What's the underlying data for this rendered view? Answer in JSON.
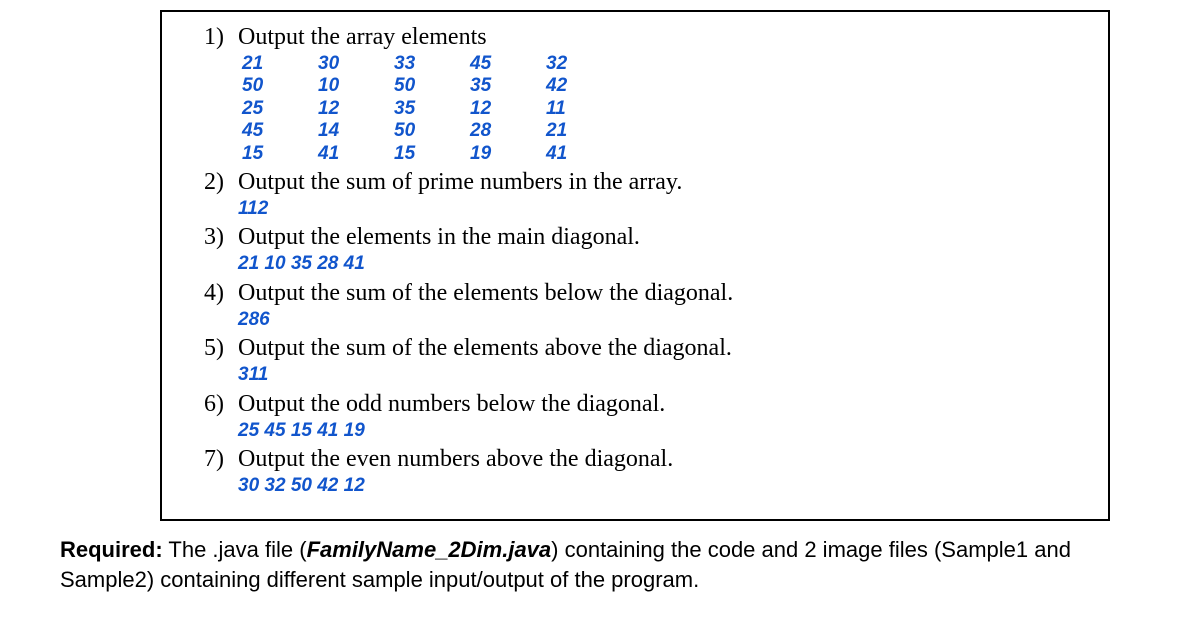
{
  "items": [
    {
      "num": "1)",
      "text": "Output the array elements",
      "output_type": "matrix",
      "matrix": [
        [
          "21",
          "30",
          "33",
          "45",
          "32"
        ],
        [
          "50",
          "10",
          "50",
          "35",
          "42"
        ],
        [
          "25",
          "12",
          "35",
          "12",
          "11"
        ],
        [
          "45",
          "14",
          "50",
          "28",
          "21"
        ],
        [
          "15",
          "41",
          "15",
          "19",
          "41"
        ]
      ]
    },
    {
      "num": "2)",
      "text": "Output the sum of prime numbers in the array.",
      "output_type": "line",
      "output": "112"
    },
    {
      "num": "3)",
      "text": "Output the elements in the main diagonal.",
      "output_type": "line",
      "output": "21 10 35 28 41"
    },
    {
      "num": "4)",
      "text": "Output the sum of the elements below the diagonal.",
      "output_type": "line",
      "output": "286"
    },
    {
      "num": "5)",
      "text": "Output the sum of the elements above the diagonal.",
      "output_type": "line",
      "output": "311"
    },
    {
      "num": "6)",
      "text": "Output the odd numbers below the diagonal.",
      "output_type": "line",
      "output": "25 45 15 41 19"
    },
    {
      "num": "7)",
      "text": "Output the even numbers above the diagonal.",
      "output_type": "line",
      "output": "30 32 50 42 12"
    }
  ],
  "footer": {
    "required_label": "Required:",
    "part1": " The .java file (",
    "filename": "FamilyName_2Dim.java",
    "part2": ") containing the code and 2 image files (Sample1 and Sample2) containing different sample input/output of the program."
  }
}
